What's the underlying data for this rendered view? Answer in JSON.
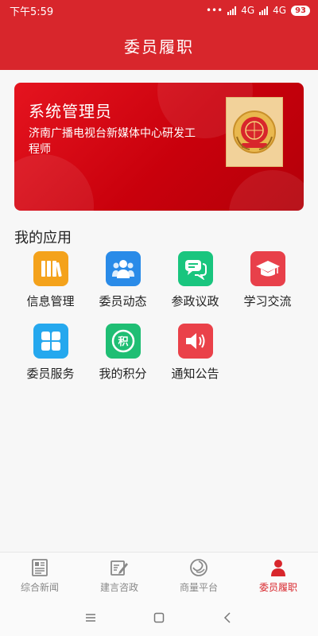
{
  "status": {
    "time": "下午5:59",
    "network1": "4G",
    "network2": "4G",
    "battery": "93"
  },
  "header": {
    "title": "委员履职"
  },
  "card": {
    "name": "系统管理员",
    "description": "济南广播电视台新媒体中心研发工程师",
    "emblem_icon": "cppcc-emblem-icon"
  },
  "section": {
    "title": "我的应用"
  },
  "apps": [
    {
      "label": "信息管理",
      "icon": "books-icon",
      "color": "#f4a21b"
    },
    {
      "label": "委员动态",
      "icon": "people-icon",
      "color": "#2a8be8"
    },
    {
      "label": "参政议政",
      "icon": "chat-icon",
      "color": "#19c57e"
    },
    {
      "label": "学习交流",
      "icon": "graduation-cap-icon",
      "color": "#e8404a"
    },
    {
      "label": "委员服务",
      "icon": "clover-icon",
      "color": "#25a8ee"
    },
    {
      "label": "我的积分",
      "icon": "points-icon",
      "color": "#1fbe74",
      "glyph": "积"
    },
    {
      "label": "通知公告",
      "icon": "speaker-icon",
      "color": "#ea4149"
    }
  ],
  "tabs": [
    {
      "label": "综合新闻",
      "icon": "newspaper-icon",
      "active": false
    },
    {
      "label": "建言咨政",
      "icon": "edit-icon",
      "active": false
    },
    {
      "label": "商量平台",
      "icon": "swirl-icon",
      "active": false
    },
    {
      "label": "委员履职",
      "icon": "person-icon",
      "active": true
    }
  ],
  "colors": {
    "primary": "#d8262c",
    "inactive_tab": "#888888"
  }
}
